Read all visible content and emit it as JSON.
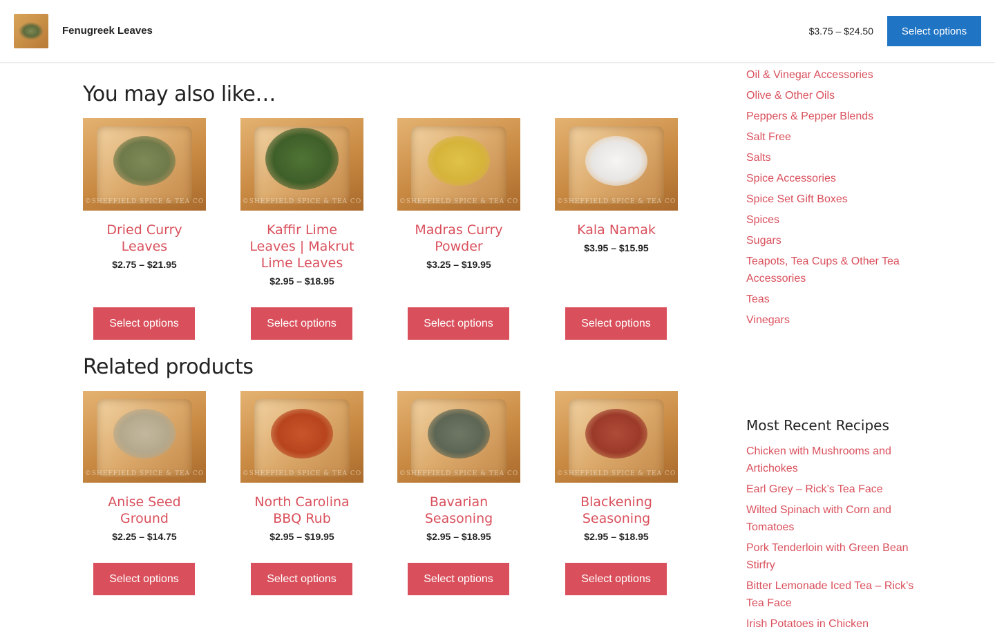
{
  "sticky": {
    "product_name": "Fenugreek Leaves",
    "price": "$3.75 – $24.50",
    "button_label": "Select options"
  },
  "upsells": {
    "title": "You may also like…",
    "products": [
      {
        "name": "Dried Curry Leaves",
        "price": "$2.75 – $21.95",
        "button": "Select options",
        "spice_color": "#6f7a4a"
      },
      {
        "name": "Kaffir Lime Leaves | Makrut Lime Leaves",
        "price": "$2.95 – $18.95",
        "button": "Select options",
        "spice_color": "#3f5f2a"
      },
      {
        "name": "Madras Curry Powder",
        "price": "$3.25 – $19.95",
        "button": "Select options",
        "spice_color": "#d6b43a"
      },
      {
        "name": "Kala Namak",
        "price": "$3.95 – $15.95",
        "button": "Select options",
        "spice_color": "#e8e6e4"
      }
    ]
  },
  "related": {
    "title": "Related products",
    "products": [
      {
        "name": "Anise Seed Ground",
        "price": "$2.25 – $14.75",
        "button": "Select options",
        "spice_color": "#b4a88c"
      },
      {
        "name": "North Carolina BBQ Rub",
        "price": "$2.95 – $19.95",
        "button": "Select options",
        "spice_color": "#b8441e"
      },
      {
        "name": "Bavarian Seasoning",
        "price": "$2.95 – $18.95",
        "button": "Select options",
        "spice_color": "#5d6654"
      },
      {
        "name": "Blackening Seasoning",
        "price": "$2.95 – $18.95",
        "button": "Select options",
        "spice_color": "#9c3a2a"
      }
    ]
  },
  "sidebar": {
    "categories": [
      "Oil & Vinegar Accessories",
      "Olive & Other Oils",
      "Peppers & Pepper Blends",
      "Salt Free",
      "Salts",
      "Spice Accessories",
      "Spice Set Gift Boxes",
      "Spices",
      "Sugars",
      "Teapots, Tea Cups & Other Tea Accessories",
      "Teas",
      "Vinegars"
    ],
    "recipes_title": "Most Recent Recipes",
    "recipes": [
      "Chicken with Mushrooms and Artichokes",
      "Earl Grey – Rick’s Tea Face",
      "Wilted Spinach with Corn and Tomatoes",
      "Pork Tenderloin with Green Bean Stirfry",
      "Bitter Lemonade Iced Tea – Rick’s Tea Face",
      "Irish Potatoes in Chicken"
    ]
  },
  "watermark": "©SHEFFIELD SPICE & TEA CO"
}
